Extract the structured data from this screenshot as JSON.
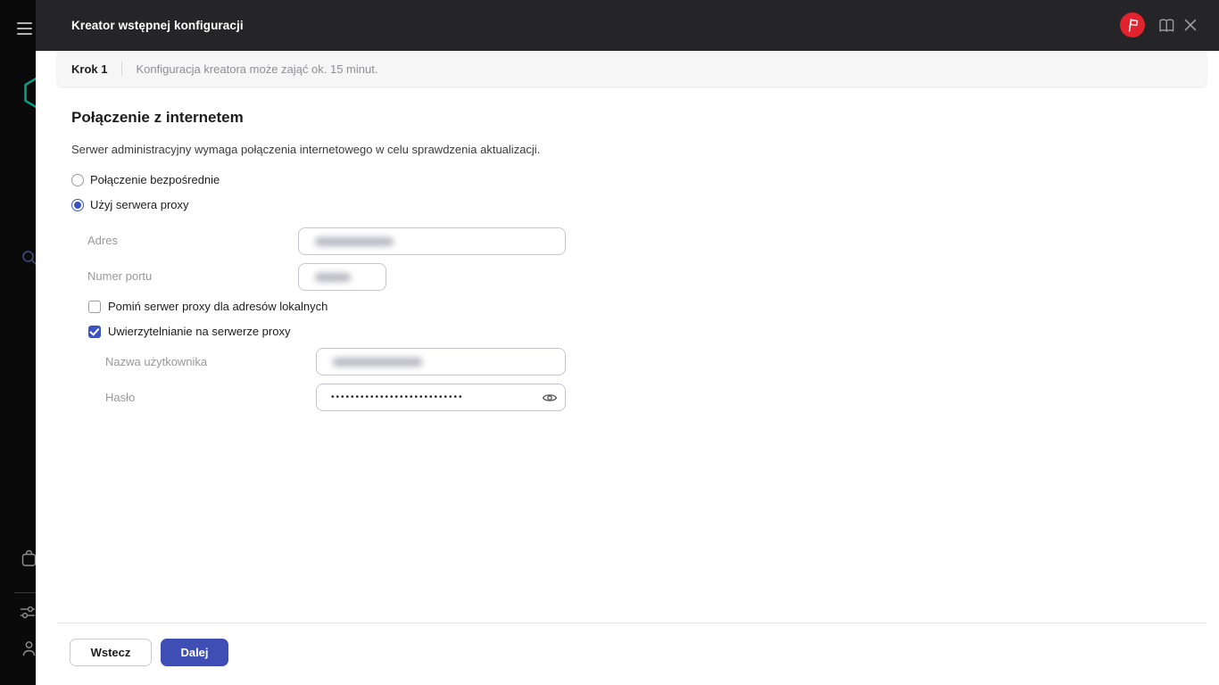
{
  "colors": {
    "brand_red": "#e1232e",
    "brand_teal": "#00a88e",
    "accent_blue": "#3c53c2",
    "primary_button_blue": "#3e4eb4",
    "header_bg": "#252527",
    "sidebar_bg": "#0a0a0b"
  },
  "header": {
    "title": "Kreator wstępnej konfiguracji",
    "icons": [
      "menu-icon",
      "whats-new-flag-icon",
      "documentation-book-icon",
      "close-icon"
    ]
  },
  "sidebar": {
    "icons": [
      "kaspersky-hexagon-logo",
      "search-icon",
      "marketplace-bag-icon",
      "console-settings-icon",
      "user-account-icon"
    ]
  },
  "step_bar": {
    "step": "Krok 1",
    "note": "Konfiguracja kreatora może zająć ok. 15 minut."
  },
  "main": {
    "title": "Połączenie z internetem",
    "description": "Serwer administracyjny wymaga połączenia internetowego w celu sprawdzenia aktualizacji.",
    "connection_options": [
      {
        "label": "Połączenie bezpośrednie",
        "selected": false
      },
      {
        "label": "Użyj serwera proxy",
        "selected": true
      }
    ],
    "proxy_form": {
      "address_label": "Adres",
      "address_value_redacted": true,
      "port_label": "Numer portu",
      "port_value_redacted": true,
      "bypass_checkbox": {
        "label": "Pomiń serwer proxy dla adresów lokalnych",
        "checked": false
      },
      "auth_checkbox": {
        "label": "Uwierzytelnianie na serwerze proxy",
        "checked": true
      },
      "username_label": "Nazwa użytkownika",
      "username_value_redacted": true,
      "password_label": "Hasło",
      "password_masked_value": "•••••••••••••••••••••••••••"
    }
  },
  "footer": {
    "back_button": "Wstecz",
    "next_button": "Dalej"
  }
}
